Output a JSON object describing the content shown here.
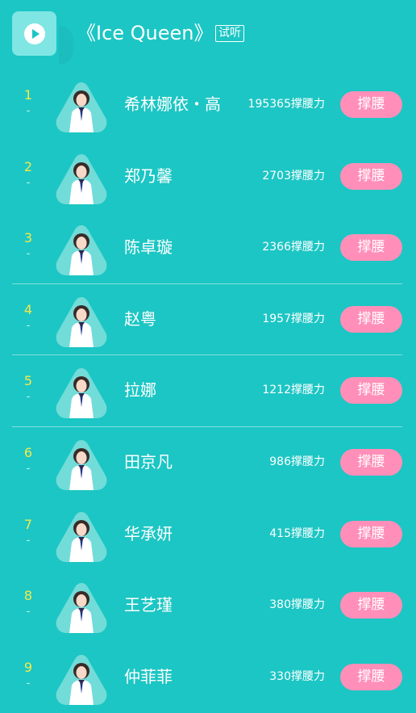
{
  "header": {
    "title": "《Ice Queen》",
    "listen_label": "试听"
  },
  "colors": {
    "background": "#1cc6c4",
    "rank": "#f4ea49",
    "button": "#ff8fb8"
  },
  "rankings": [
    {
      "rank": "1",
      "trend": "-",
      "name": "希林娜依・高",
      "score": "195365撑腰力",
      "button": "撑腰",
      "divider": false
    },
    {
      "rank": "2",
      "trend": "-",
      "name": "郑乃馨",
      "score": "2703撑腰力",
      "button": "撑腰",
      "divider": false
    },
    {
      "rank": "3",
      "trend": "-",
      "name": "陈卓璇",
      "score": "2366撑腰力",
      "button": "撑腰",
      "divider": true
    },
    {
      "rank": "4",
      "trend": "-",
      "name": "赵粤",
      "score": "1957撑腰力",
      "button": "撑腰",
      "divider": true
    },
    {
      "rank": "5",
      "trend": "-",
      "name": "拉娜",
      "score": "1212撑腰力",
      "button": "撑腰",
      "divider": true
    },
    {
      "rank": "6",
      "trend": "-",
      "name": "田京凡",
      "score": "986撑腰力",
      "button": "撑腰",
      "divider": false
    },
    {
      "rank": "7",
      "trend": "-",
      "name": "华承妍",
      "score": "415撑腰力",
      "button": "撑腰",
      "divider": false
    },
    {
      "rank": "8",
      "trend": "-",
      "name": "王艺瑾",
      "score": "380撑腰力",
      "button": "撑腰",
      "divider": false
    },
    {
      "rank": "9",
      "trend": "-",
      "name": "仲菲菲",
      "score": "330撑腰力",
      "button": "撑腰",
      "divider": false
    }
  ]
}
